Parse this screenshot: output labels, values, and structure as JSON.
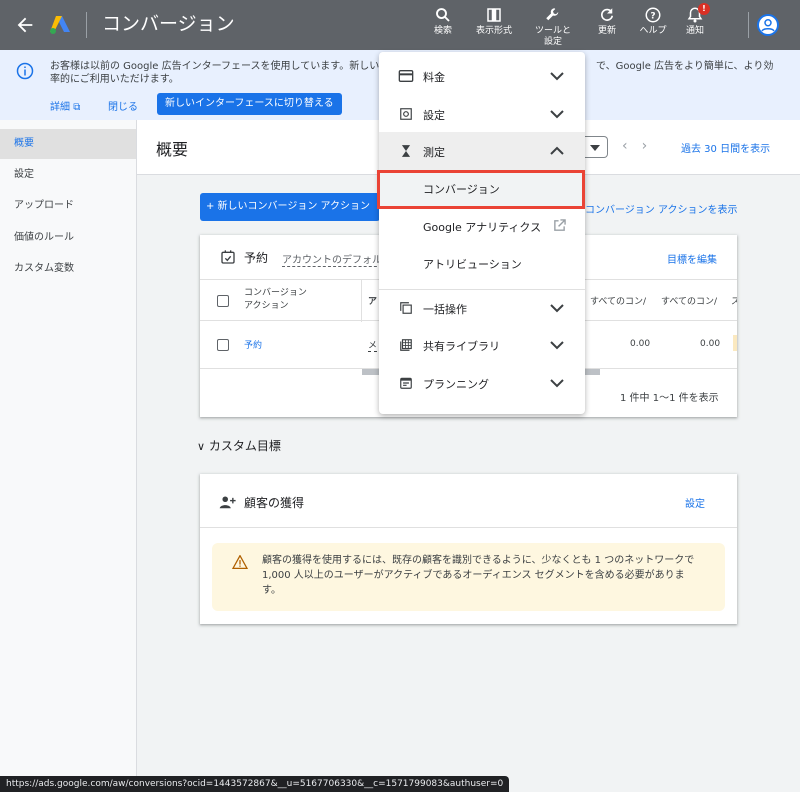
{
  "topbar": {
    "title": "コンバージョン",
    "actions": [
      {
        "label": "検索",
        "icon": "search-icon"
      },
      {
        "label": "表示形式",
        "icon": "appearance-icon"
      },
      {
        "label": "ツールと\n設定",
        "icon": "wrench-icon"
      },
      {
        "label": "更新",
        "icon": "refresh-icon"
      },
      {
        "label": "ヘルプ",
        "icon": "help-icon"
      },
      {
        "label": "通知",
        "icon": "bell-icon",
        "badge": "!"
      }
    ]
  },
  "notice": {
    "message_left": "お客様は以前の Google 広告インターフェースを使用しています。新しい",
    "message_left_2": "率的にご利用いただけます。",
    "message_right": "で、Google 広告をより簡単に、より効",
    "details_link": "詳細",
    "close_link": "閉じる",
    "switch_button": "新しいインターフェースに切り替える"
  },
  "leftnav": {
    "items": [
      {
        "label": "概要",
        "active": true
      },
      {
        "label": "設定",
        "active": false
      },
      {
        "label": "アップロード",
        "active": false
      },
      {
        "label": "価値のルール",
        "active": false
      },
      {
        "label": "カスタム変数",
        "active": false
      }
    ]
  },
  "page": {
    "title": "概要",
    "date_range": "過去 30 日間を表示",
    "new_action_button": "+ 新しいコンバージョン アクション",
    "show_all_link": "コンバージョン アクションを表示"
  },
  "goal_card": {
    "title": "予約",
    "subtitle": "アカウントのデフォル",
    "edit_link": "目標を編集",
    "columns": [
      "コンバージョン\nアクション",
      "ア",
      "すべてのコン/",
      "すべてのコン/",
      "ス"
    ],
    "rows": [
      {
        "action": "予約",
        "col2": "メ",
        "val1": "0.00",
        "val2": "0.00"
      }
    ],
    "pagination": "1 件中 1〜1 件を表示"
  },
  "custom_goals": {
    "heading": "カスタム目標",
    "card_title": "顧客の獲得",
    "settings_link": "設定",
    "warning": "顧客の獲得を使用するには、既存の顧客を識別できるように、少なくとも 1 つのネットワークで 1,000 人以上のユーザーがアクティブであるオーディエンス セグメントを含める必要があります。"
  },
  "menu": {
    "sections": [
      {
        "label": "料金",
        "icon": "billing-icon",
        "expanded": false
      },
      {
        "label": "設定",
        "icon": "settings-icon",
        "expanded": false
      },
      {
        "label": "測定",
        "icon": "hourglass-icon",
        "expanded": true
      },
      {
        "label": "一括操作",
        "icon": "bulk-icon",
        "expanded": false
      },
      {
        "label": "共有ライブラリ",
        "icon": "library-icon",
        "expanded": false
      },
      {
        "label": "プランニング",
        "icon": "planning-icon",
        "expanded": false
      }
    ],
    "measurement_items": [
      {
        "label": "コンバージョン",
        "highlighted": true
      },
      {
        "label": "Google アナリティクス",
        "external": true
      },
      {
        "label": "アトリビューション"
      }
    ]
  },
  "status_url": "https://ads.google.com/aw/conversions?ocid=1443572867&__u=5167706330&__c=1571799083&authuser=0",
  "colors": {
    "topbar": "#5f6368",
    "accent": "#1a73e8",
    "highlight_box": "#ea4335",
    "warning_bg": "#fef7e0"
  }
}
